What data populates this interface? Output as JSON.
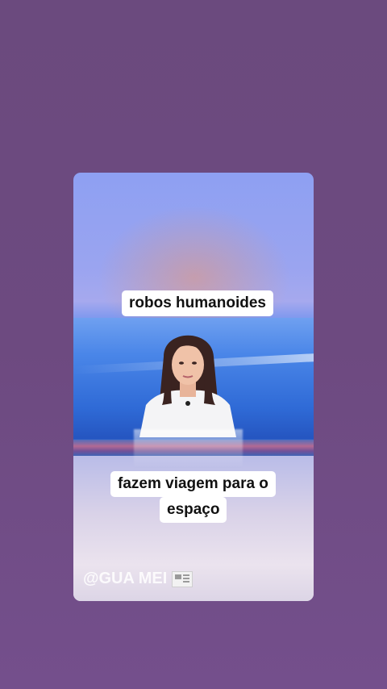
{
  "story": {
    "captions": {
      "top": "robos humanoides",
      "bottom_line1": "fazem viagem para o",
      "bottom_line2": "espaço"
    },
    "watermark": {
      "handle": "@GUA MEI",
      "icon": "newspaper-icon"
    }
  },
  "colors": {
    "background": "#6d4a80",
    "caption_bg": "#ffffff",
    "studio_blue": "#2f6ad6"
  }
}
